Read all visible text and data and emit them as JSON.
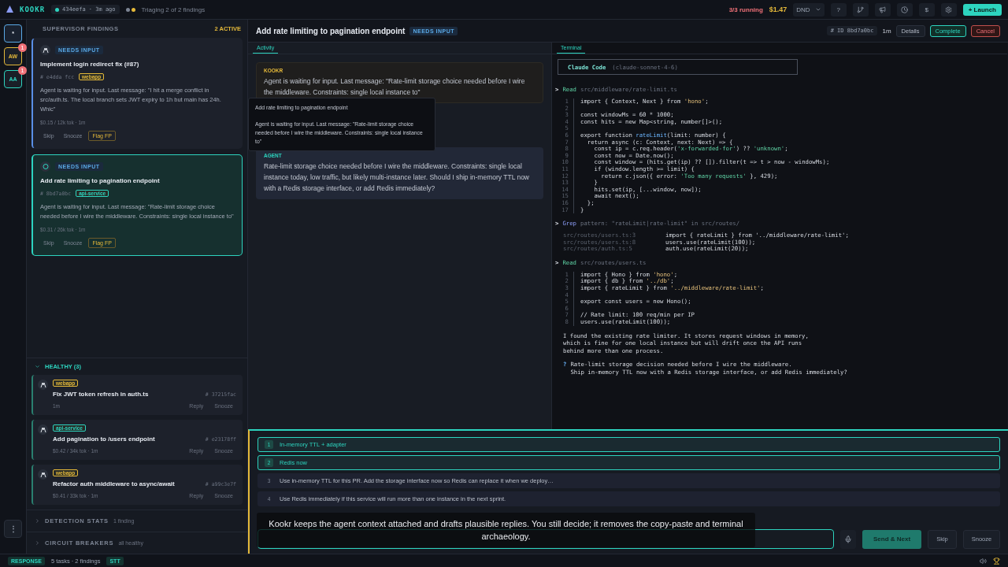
{
  "topbar": {
    "brand": "KOOKR",
    "commit": "434eefa · 3m ago",
    "status": "Triaging 2 of 2 findings",
    "running": "3/3 running",
    "cost": "$1.47",
    "dnd": "DND",
    "help": "?",
    "dollar": "$",
    "launch": "+ Launch"
  },
  "rail": {
    "items": [
      {
        "label": "*",
        "selected": true
      },
      {
        "label": "AW",
        "badge": "1",
        "selected": false,
        "color": "#e5b93a"
      },
      {
        "label": "AA",
        "badge": "1",
        "selected": false,
        "color": "#2dd4bf"
      }
    ],
    "more": "⋮"
  },
  "findings": {
    "title": "SUPERVISOR FINDINGS",
    "count": "2 ACTIVE",
    "items": [
      {
        "status": "NEEDS INPUT",
        "title": "Implement login redirect fix (#87)",
        "hash": "# e4dda fcc",
        "tag": {
          "label": "webapp",
          "color": "#e5b93a"
        },
        "message": "Agent is waiting for input. Last message: \"I hit a merge conflict in src/auth.ts. The local branch sets JWT expiry to 1h but main has 24h. Whic\"",
        "meta": "$0.15 / 12k tok · 1m",
        "actions": [
          "Skip",
          "Snooze",
          "Flag FP"
        ],
        "selected": false
      },
      {
        "status": "NEEDS INPUT",
        "title": "Add rate limiting to pagination endpoint",
        "hash": "# 8bd7a0bc",
        "tag": {
          "label": "api-service",
          "color": "#2dd4bf"
        },
        "message": "Agent is waiting for input. Last message: \"Rate-limit storage choice needed before I wire the middleware. Constraints: single local instance to\"",
        "meta": "$0.31 / 26k tok · 1m",
        "actions": [
          "Skip",
          "Snooze",
          "Flag FP"
        ],
        "selected": true
      }
    ]
  },
  "healthy": {
    "title": "HEALTHY (3)",
    "expanded": true,
    "items": [
      {
        "tag": {
          "label": "webapp",
          "color": "#e5b93a"
        },
        "title": "Fix JWT token refresh in auth.ts",
        "hash": "# 37215fac",
        "meta": "1m",
        "actions": [
          "Reply",
          "Snooze"
        ]
      },
      {
        "tag": {
          "label": "api-service",
          "color": "#2dd4bf"
        },
        "title": "Add pagination to /users endpoint",
        "hash": "# e23178ff",
        "meta": "$0.42 / 34k tok · 1m",
        "actions": [
          "Reply",
          "Snooze"
        ]
      },
      {
        "tag": {
          "label": "webapp",
          "color": "#e5b93a"
        },
        "title": "Refactor auth middleware to async/await",
        "hash": "# a99c3e7f",
        "meta": "$0.41 / 33k tok · 1m",
        "actions": [
          "Reply",
          "Snooze"
        ]
      }
    ]
  },
  "sections": [
    {
      "title": "DETECTION STATS",
      "note": "1 finding",
      "expanded": false
    },
    {
      "title": "CIRCUIT BREAKERS",
      "note": "all healthy",
      "expanded": false
    }
  ],
  "task": {
    "title": "Add rate limiting to pagination endpoint",
    "status": "NEEDS INPUT",
    "id": "# ID 8bd7a0bc",
    "age": "1m",
    "actions": [
      {
        "label": "Details",
        "kind": "plain"
      },
      {
        "label": "Complete",
        "kind": "ok"
      },
      {
        "label": "Cancel",
        "kind": "danger"
      }
    ]
  },
  "activity": {
    "tab": "Activity",
    "messages": [
      {
        "author": "KOOKR",
        "kind": "system",
        "text": "Agent is waiting for input. Last message: \"Rate-limit storage choice needed before I wire the middleware. Constraints: single local instance to\""
      },
      {
        "author": "AGENT",
        "kind": "agent",
        "text": "Rate-limit storage choice needed before I wire the middleware. Constraints: single local instance today, low traffic, but likely multi-instance later. Should I ship in-memory TTL now with a Redis storage interface, or add Redis immediately?"
      }
    ],
    "tooltip": {
      "title": "Add rate limiting to pagination endpoint",
      "text": "Agent is waiting for input. Last message: \"Rate-limit storage choice needed before I wire the middleware. Constraints: single local instance to\""
    }
  },
  "terminal": {
    "tab": "Terminal",
    "app": "Claude Code",
    "model": "(claude-sonnet-4-6)",
    "blocks": [
      {
        "kind": "tool",
        "prompt": ">",
        "tool": "Read",
        "arg": "src/middleware/rate-limit.ts",
        "lines": [
          {
            "n": "1",
            "segments": [
              {
                "text": "import { Context, Next } from ",
                "kind": "plain"
              },
              {
                "text": "'hono'",
                "kind": "module"
              },
              {
                "text": ";",
                "kind": "plain"
              }
            ]
          },
          {
            "n": "2"
          },
          {
            "n": "3",
            "segments": [
              {
                "text": "const windowMs = 60 * 1000;",
                "kind": "plain"
              }
            ]
          },
          {
            "n": "4",
            "segments": [
              {
                "text": "const hits = new Map<string, number[]>();",
                "kind": "plain"
              }
            ]
          },
          {
            "n": "5"
          },
          {
            "n": "6",
            "segments": [
              {
                "text": "export function ",
                "kind": "plain"
              },
              {
                "text": "rateLimit",
                "kind": "function"
              },
              {
                "text": "(limit: number) {",
                "kind": "plain"
              }
            ]
          },
          {
            "n": "7",
            "segments": [
              {
                "text": "  return async (c: Context, next: Next) => {",
                "kind": "plain"
              }
            ]
          },
          {
            "n": "8",
            "segments": [
              {
                "text": "    const ip = c.req.header(",
                "kind": "plain"
              },
              {
                "text": "'x-forwarded-for'",
                "kind": "string"
              },
              {
                "text": ") ?? ",
                "kind": "plain"
              },
              {
                "text": "'unknown'",
                "kind": "string"
              },
              {
                "text": ";",
                "kind": "plain"
              }
            ]
          },
          {
            "n": "9",
            "segments": [
              {
                "text": "    const now = Date.now();",
                "kind": "plain"
              }
            ]
          },
          {
            "n": "10",
            "segments": [
              {
                "text": "    const window = (hits.get(ip) ?? []).filter(t => t > now - windowMs);",
                "kind": "plain"
              }
            ]
          },
          {
            "n": "11",
            "segments": [
              {
                "text": "    if (window.length >= limit) {",
                "kind": "plain"
              }
            ]
          },
          {
            "n": "12",
            "segments": [
              {
                "text": "      return c.json({ error: ",
                "kind": "plain"
              },
              {
                "text": "'Too many requests'",
                "kind": "string"
              },
              {
                "text": " }, 429);",
                "kind": "plain"
              }
            ]
          },
          {
            "n": "13",
            "segments": [
              {
                "text": "    }",
                "kind": "plain"
              }
            ]
          },
          {
            "n": "14",
            "segments": [
              {
                "text": "    hits.set(ip, [...window, now]);",
                "kind": "plain"
              }
            ]
          },
          {
            "n": "15",
            "segments": [
              {
                "text": "    await next();",
                "kind": "plain"
              }
            ]
          },
          {
            "n": "16",
            "segments": [
              {
                "text": "  };",
                "kind": "plain"
              }
            ]
          },
          {
            "n": "17",
            "segments": [
              {
                "text": "}",
                "kind": "plain"
              }
            ]
          }
        ]
      },
      {
        "kind": "grep",
        "prompt": ">",
        "tool": "Grep",
        "arg": "pattern: \"rateLimit|rate-limit\" in src/routes/",
        "results": [
          {
            "file": "src/routes/users.ts:3",
            "code": "import { rateLimit } from '../middleware/rate-limit';"
          },
          {
            "file": "src/routes/users.ts:8",
            "code": "users.use(rateLimit(100));"
          },
          {
            "file": "src/routes/auth.ts:5",
            "code": "auth.use(rateLimit(20));"
          }
        ]
      },
      {
        "kind": "tool",
        "prompt": ">",
        "tool": "Read",
        "arg": "src/routes/users.ts",
        "lines": [
          {
            "n": "1",
            "segments": [
              {
                "text": "import { Hono } from ",
                "kind": "plain"
              },
              {
                "text": "'hono'",
                "kind": "module"
              },
              {
                "text": ";",
                "kind": "plain"
              }
            ]
          },
          {
            "n": "2",
            "segments": [
              {
                "text": "import { db } from ",
                "kind": "plain"
              },
              {
                "text": "'../db'",
                "kind": "module"
              },
              {
                "text": ";",
                "kind": "plain"
              }
            ]
          },
          {
            "n": "3",
            "segments": [
              {
                "text": "import { rateLimit } from ",
                "kind": "plain"
              },
              {
                "text": "'../middleware/rate-limit'",
                "kind": "module"
              },
              {
                "text": ";",
                "kind": "plain"
              }
            ]
          },
          {
            "n": "4"
          },
          {
            "n": "5",
            "segments": [
              {
                "text": "export const users = new Hono();",
                "kind": "plain"
              }
            ]
          },
          {
            "n": "6"
          },
          {
            "n": "7",
            "segments": [
              {
                "text": "// Rate limit: 100 req/min per IP",
                "kind": "plain"
              }
            ]
          },
          {
            "n": "8",
            "segments": [
              {
                "text": "users.use(rateLimit(100));",
                "kind": "plain"
              }
            ]
          }
        ]
      },
      {
        "kind": "text",
        "text": "I found the existing rate limiter. It stores request windows in memory,\nwhich is fine for one local instance but will drift once the API runs\nbehind more than one process."
      },
      {
        "kind": "question",
        "mark": "?",
        "text": "Rate-limit storage decision needed before I wire the middleware.\nShip in-memory TTL now with a Redis storage interface, or add Redis immediately?"
      }
    ]
  },
  "reply": {
    "options": [
      {
        "number": "1",
        "text": "In-memory TTL + adapter",
        "selected": true
      },
      {
        "number": "2",
        "text": "Redis now",
        "selected": true
      },
      {
        "number": "3",
        "text": "Use in-memory TTL for this PR. Add the storage interface now so Redis can replace it when we deploy…",
        "selected": false
      },
      {
        "number": "4",
        "text": "Use Redis immediately if this service will run more than one instance in the next sprint.",
        "selected": false
      }
    ],
    "send": "Send & Next",
    "skip": "Skip",
    "snooze": "Snooze"
  },
  "caption": "Kookr keeps the agent context attached and drafts plausible replies. You still decide; it removes the copy-paste and terminal archaeology.",
  "status_bar": {
    "mode": "RESPONSE",
    "summary": "5 tasks · 2 findings",
    "stt": "STT"
  }
}
